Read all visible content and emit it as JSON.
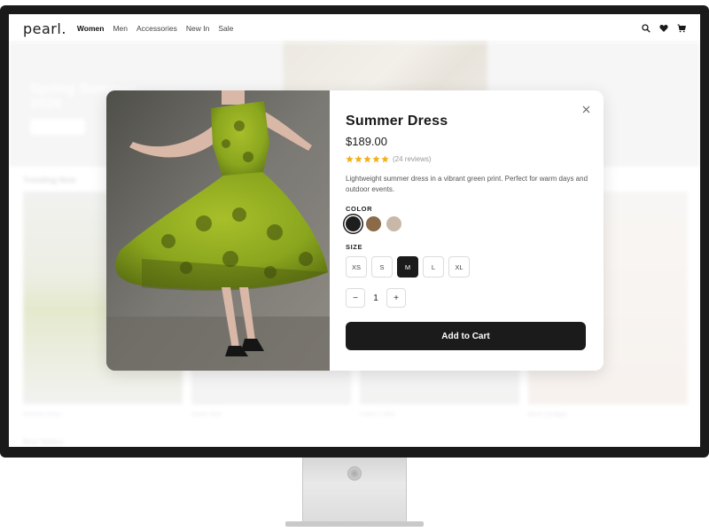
{
  "nav": {
    "logo": "pearl.",
    "links": [
      "Women",
      "Men",
      "Accessories",
      "New In",
      "Sale"
    ],
    "active_link": "Women",
    "icons": [
      "search-icon",
      "heart-icon",
      "cart-icon"
    ]
  },
  "background": {
    "hero_title": "Spring Summer 2026",
    "trending_label": "Trending Now",
    "cards": [
      {
        "name": "Summer Dress"
      },
      {
        "name": "Denim Skirt"
      },
      {
        "name": "Cotton T-Shirt"
      },
      {
        "name": "Blush Cardigan"
      }
    ],
    "best_sellers_label": "Best Sellers"
  },
  "modal": {
    "title": "Summer Dress",
    "price": "$189.00",
    "rating": 5,
    "reviews": "(24 reviews)",
    "description": "Lightweight summer dress in a vibrant green print. Perfect for warm days and outdoor events.",
    "color_label": "COLOR",
    "colors": [
      {
        "name": "black",
        "hex": "#1e1e1e",
        "selected": true
      },
      {
        "name": "brown",
        "hex": "#8a6a48",
        "selected": false
      },
      {
        "name": "beige",
        "hex": "#c9b8a8",
        "selected": false
      }
    ],
    "size_label": "SIZE",
    "sizes": [
      "XS",
      "S",
      "M",
      "L",
      "XL"
    ],
    "selected_size": "M",
    "quantity": "1",
    "minus_label": "−",
    "plus_label": "+",
    "cta": "Add to Cart",
    "star_color": "#f2b01e",
    "accent": "#1b1b1b"
  }
}
